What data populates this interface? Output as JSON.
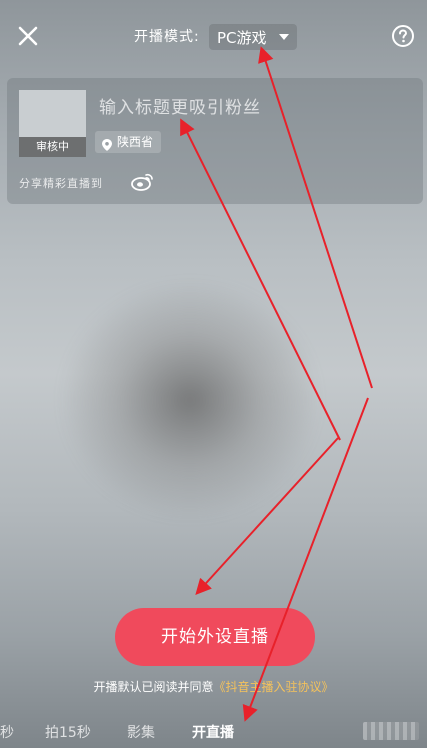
{
  "header": {
    "mode_label": "开播模式:",
    "mode_value": "PC游戏"
  },
  "card": {
    "cover_badge": "审核中",
    "title_placeholder": "输入标题更吸引粉丝",
    "location": "陕西省",
    "share_label": "分享精彩直播到"
  },
  "start_button": "开始外设直播",
  "agreement": {
    "prefix": "开播默认已阅读并同意",
    "link": "《抖音主播入驻协议》"
  },
  "tabs": [
    {
      "label": "秒"
    },
    {
      "label": "拍15秒"
    },
    {
      "label": "影集"
    },
    {
      "label": "开直播"
    }
  ],
  "colors": {
    "start_button": "#f04a5c",
    "agreement_link": "#f4c25c",
    "annotation_arrows": "#e8212a"
  },
  "icons": [
    "close-icon",
    "help-icon",
    "location-pin-icon",
    "weibo-icon"
  ]
}
